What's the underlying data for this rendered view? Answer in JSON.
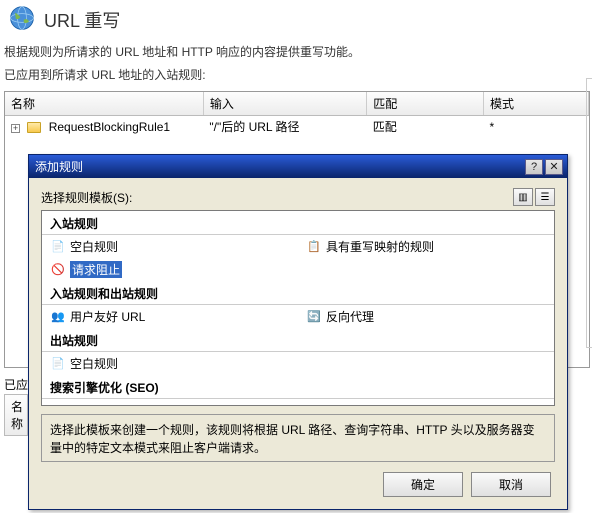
{
  "header": {
    "title": "URL 重写",
    "desc1": "根据规则为所请求的 URL 地址和 HTTP 响应的内容提供重写功能。",
    "desc2": "已应用到所请求 URL 地址的入站规则:"
  },
  "table": {
    "columns": {
      "name": "名称",
      "input": "输入",
      "match": "匹配",
      "mode": "模式"
    },
    "rows": [
      {
        "name": "RequestBlockingRule1",
        "input": "\"/\"后的 URL 路径",
        "match": "匹配",
        "mode": "*"
      }
    ]
  },
  "behind": {
    "applied_label": "已应",
    "name_col": "名称"
  },
  "dialog": {
    "title": "添加规则",
    "select_label": "选择规则模板(S):",
    "sections": {
      "inbound": "入站规则",
      "both": "入站规则和出站规则",
      "outbound": "出站规则",
      "seo": "搜索引擎优化 (SEO)"
    },
    "items": {
      "blank_inbound": "空白规则",
      "with_mapping": "具有重写映射的规则",
      "request_block": "请求阻止",
      "user_friendly": "用户友好 URL",
      "reverse_proxy": "反向代理",
      "blank_outbound": "空白规则"
    },
    "hint": "选择此模板来创建一个规则，该规则将根据 URL 路径、查询字符串、HTTP 头以及服务器变量中的特定文本模式来阻止客户端请求。",
    "buttons": {
      "ok": "确定",
      "cancel": "取消",
      "help": "?",
      "close": "✕"
    }
  }
}
